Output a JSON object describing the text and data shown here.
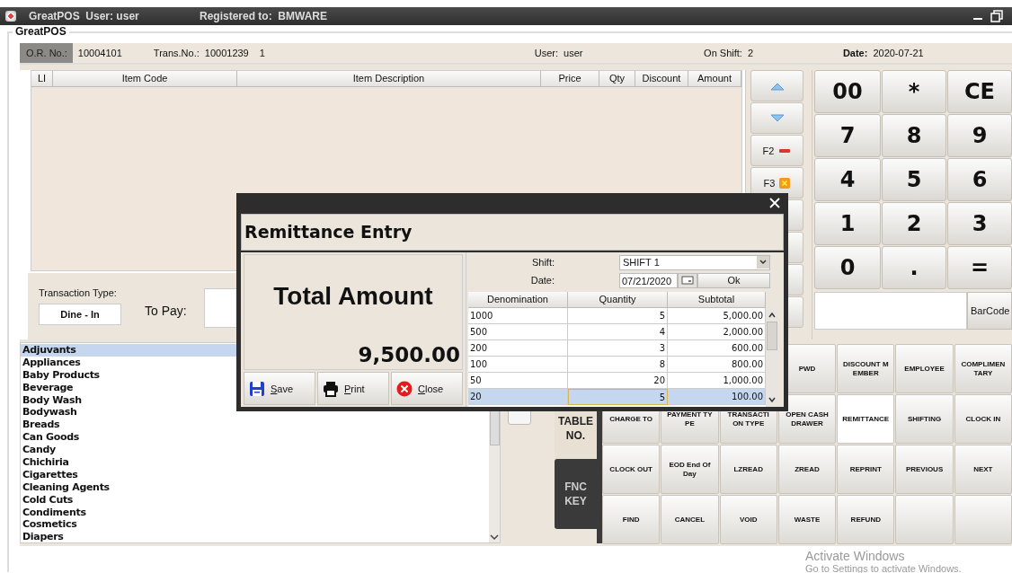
{
  "window": {
    "title": "GreatPOS  User: user",
    "registered": "Registered to:  BMWARE"
  },
  "group_title": "GreatPOS",
  "header": {
    "or_label": "O.R. No.:",
    "or_value": "10004101",
    "trans_label": "Trans.No.:",
    "trans_value": "10001239",
    "count": "1",
    "user_label": "User:",
    "user_value": "user",
    "shift_label": "On Shift:",
    "shift_value": "2",
    "date_label": "Date:",
    "date_value": "2020-07-21"
  },
  "items_table": {
    "columns": [
      "LI",
      "Item Code",
      "Item Description",
      "Price",
      "Qty",
      "Discount",
      "Amount"
    ]
  },
  "transaction": {
    "type_label": "Transaction Type:",
    "type_button": "Dine - In",
    "to_pay_label": "To Pay:"
  },
  "side_buttons": [
    {
      "kind": "up"
    },
    {
      "kind": "down"
    },
    {
      "kind": "f2",
      "label": "F2"
    },
    {
      "kind": "f3",
      "label": "F3"
    },
    {
      "kind": "blank"
    },
    {
      "kind": "blank"
    },
    {
      "kind": "blank"
    },
    {
      "kind": "blank"
    }
  ],
  "keypad": {
    "keys": [
      "00",
      "*",
      "CE",
      "7",
      "8",
      "9",
      "4",
      "5",
      "6",
      "1",
      "2",
      "3",
      "0",
      ".",
      "="
    ],
    "barcode_button": "BarCode"
  },
  "categories": [
    {
      "label": "Adjuvants",
      "selected": true
    },
    {
      "label": "Appliances",
      "selected": false
    },
    {
      "label": "Baby Products",
      "selected": false
    },
    {
      "label": "Beverage",
      "selected": false
    },
    {
      "label": "Body Wash",
      "selected": false
    },
    {
      "label": "Bodywash",
      "selected": false
    },
    {
      "label": "Breads",
      "selected": false
    },
    {
      "label": "Can Goods",
      "selected": false
    },
    {
      "label": "Candy",
      "selected": false
    },
    {
      "label": "Chichiria",
      "selected": false
    },
    {
      "label": "Cigarettes",
      "selected": false
    },
    {
      "label": "Cleaning Agents",
      "selected": false
    },
    {
      "label": "Cold Cuts",
      "selected": false
    },
    {
      "label": "Condiments",
      "selected": false
    },
    {
      "label": "Cosmetics",
      "selected": false
    },
    {
      "label": "Diapers",
      "selected": false
    }
  ],
  "tabs": [
    {
      "label": "TABLE NO.",
      "selected": false
    },
    {
      "label": "FNC KEY",
      "selected": true
    }
  ],
  "function_keys": [
    {
      "label": "PWD",
      "selected": false
    },
    {
      "label": "DISCOUNT MEMBER",
      "selected": false
    },
    {
      "label": "EMPLOYEE",
      "selected": false
    },
    {
      "label": "COMPLIMENTARY",
      "selected": false
    },
    {
      "label": "CHARGE TO",
      "selected": false
    },
    {
      "label": "PAYMENT TYPE",
      "selected": false
    },
    {
      "label": "TRANSACTION TYPE",
      "selected": false
    },
    {
      "label": "OPEN CASH DRAWER",
      "selected": false
    },
    {
      "label": "REMITTANCE",
      "selected": true
    },
    {
      "label": "SHIFTING",
      "selected": false
    },
    {
      "label": "CLOCK IN",
      "selected": false
    },
    {
      "label": "CLOCK OUT",
      "selected": false
    },
    {
      "label": "EOD End Of Day",
      "selected": false
    },
    {
      "label": "LZREAD",
      "selected": false
    },
    {
      "label": "ZREAD",
      "selected": false
    },
    {
      "label": "REPRINT",
      "selected": false
    },
    {
      "label": "PREVIOUS",
      "selected": false
    },
    {
      "label": "NEXT",
      "selected": false
    },
    {
      "label": "FIND",
      "selected": false
    },
    {
      "label": "CANCEL",
      "selected": false
    },
    {
      "label": "VOID",
      "selected": false
    },
    {
      "label": "WASTE",
      "selected": false
    },
    {
      "label": "REFUND",
      "selected": false
    },
    {
      "selected": false
    },
    {
      "selected": false
    }
  ],
  "dialog": {
    "title": "Remittance Entry",
    "total_label": "Total Amount",
    "total_value": "9,500.00",
    "buttons": [
      {
        "kind": "save",
        "label": "Save"
      },
      {
        "kind": "print",
        "label": "Print"
      },
      {
        "kind": "close",
        "label": "Close"
      }
    ],
    "shift_label": "Shift:",
    "shift_value": "SHIFT 1",
    "date_label": "Date:",
    "date_value": "07/21/2020",
    "ok_button": "Ok",
    "columns": [
      "Denomination",
      "Quantity",
      "Subtotal"
    ],
    "rows": [
      {
        "cells": [
          "1000",
          "5",
          "5,000.00"
        ],
        "selected": false
      },
      {
        "cells": [
          "500",
          "4",
          "2,000.00"
        ],
        "selected": false
      },
      {
        "cells": [
          "200",
          "3",
          "600.00"
        ],
        "selected": false
      },
      {
        "cells": [
          "100",
          "8",
          "800.00"
        ],
        "selected": false
      },
      {
        "cells": [
          "50",
          "20",
          "1,000.00"
        ],
        "selected": false
      },
      {
        "cells": [
          "20",
          "5",
          "100.00"
        ],
        "selected": true
      }
    ]
  },
  "os_watermark": {
    "title": "Activate Windows",
    "subtitle": "Go to Settings to activate Windows."
  }
}
